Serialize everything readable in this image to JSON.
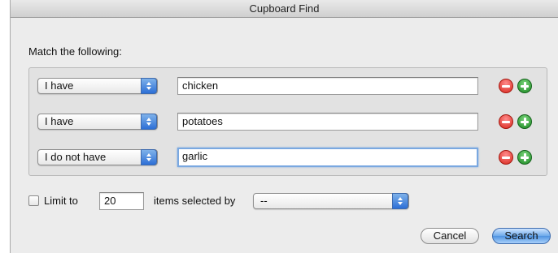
{
  "window": {
    "title": "Cupboard Find"
  },
  "match_label": "Match the following:",
  "rules": [
    {
      "condition": "I have",
      "value": "chicken",
      "focused": false
    },
    {
      "condition": "I have",
      "value": "potatoes",
      "focused": false
    },
    {
      "condition": "I do not have",
      "value": "garlic",
      "focused": true
    }
  ],
  "limit": {
    "checkbox_checked": false,
    "label": "Limit to",
    "count": "20",
    "selected_by_label": "items selected by",
    "selected_by_value": "--"
  },
  "buttons": {
    "cancel": "Cancel",
    "search": "Search"
  },
  "colors": {
    "accent": "#4f93e1",
    "remove": "#d8281e",
    "add": "#1d8a24",
    "focus": "#7aa8e0"
  }
}
